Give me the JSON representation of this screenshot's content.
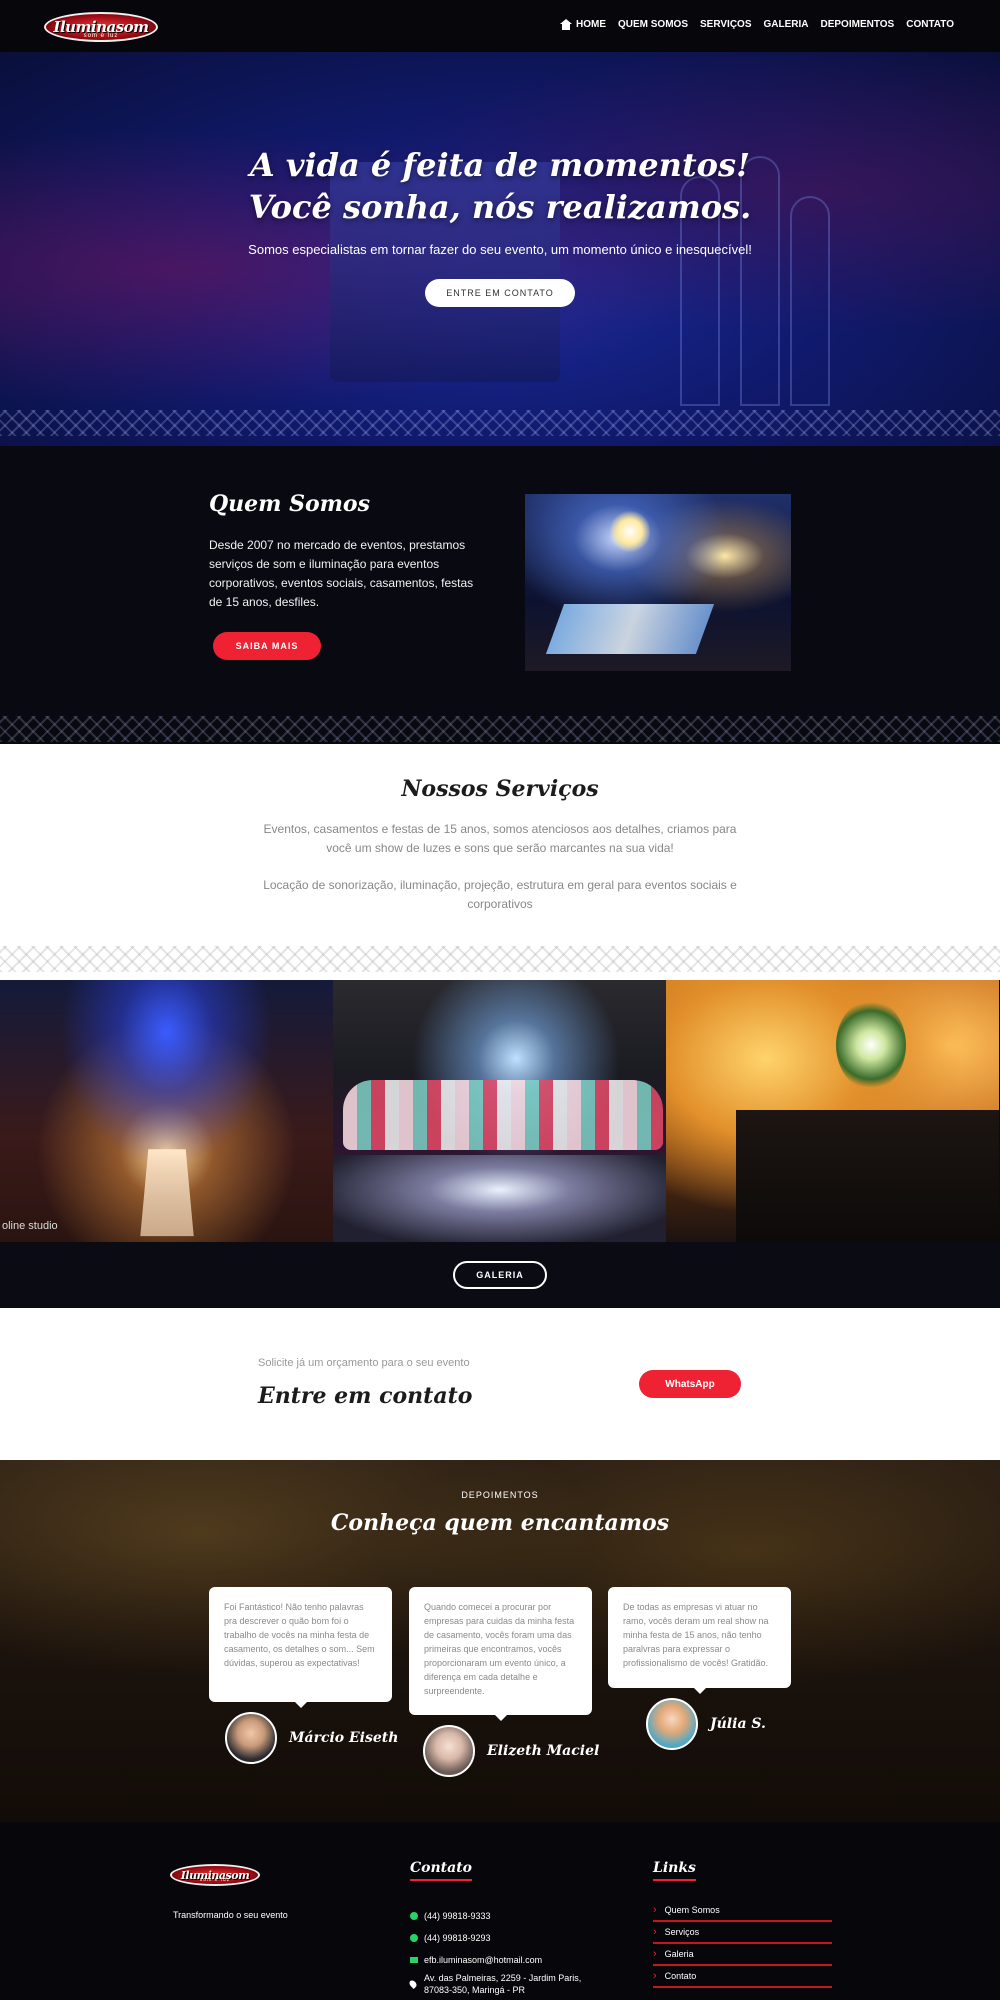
{
  "nav": {
    "logo_text": "Iluminasom",
    "logo_sub": "som e luz",
    "items": [
      "HOME",
      "QUEM SOMOS",
      "SERVIÇOS",
      "GALERIA",
      "DEPOIMENTOS",
      "CONTATO"
    ]
  },
  "hero": {
    "title_line1": "A vida é feita de momentos!",
    "title_line2": "Você sonha, nós realizamos.",
    "subtitle": "Somos especialistas em tornar fazer do seu evento, um momento único e inesquecível!",
    "button": "ENTRE EM CONTATO"
  },
  "about": {
    "title": "Quem Somos",
    "text": "Desde 2007 no mercado de eventos, prestamos serviços de som e iluminação para eventos corporativos, eventos sociais, casamentos, festas de 15 anos, desfiles.",
    "button": "SAIBA MAIS"
  },
  "services": {
    "title": "Nossos Serviços",
    "p1": "Eventos, casamentos e festas de 15 anos, somos atenciosos aos detalhes, criamos para você um show de luzes e sons que serão marcantes na sua vida!",
    "p2": "Locação de sonorização, iluminação, projeção, estrutura em geral para eventos sociais e corporativos"
  },
  "gallery": {
    "caption1": "oline studio",
    "button": "GALERIA"
  },
  "cta": {
    "small": "Solicite já um orçamento para o seu evento",
    "title": "Entre em contato",
    "button": "WhatsApp"
  },
  "testimonials": {
    "overline": "DEPOIMENTOS",
    "title": "Conheça quem encantamos",
    "items": [
      {
        "text": "Foi Fantástico! Não tenho palavras pra descrever o quão bom foi o trabalho de vocês na minha festa de casamento, os detalhes o som... Sem dúvidas, superou as expectativas!",
        "name": "Márcio Eiseth"
      },
      {
        "text": "Quando comecei a procurar por empresas para cuidas da minha festa de casamento, vocês foram uma das primeiras que encontramos, vocês proporcionaram um evento único, a diferença em cada detalhe e surpreendente.",
        "name": "Elizeth Maciel"
      },
      {
        "text": "De todas as empresas vi atuar no ramo, vocês deram um real show na minha festa de 15 anos, não tenho paralvras para expressar o profissionalismo de vocês! Gratidão.",
        "name": "Júlia S."
      }
    ]
  },
  "footer": {
    "tagline": "Transformando o seu evento",
    "contato_title": "Contato",
    "phone1": "(44) 99818-9333",
    "phone2": "(44) 99818-9293",
    "email": "efb.iluminasom@hotmail.com",
    "address_line1": "Av. das Palmeiras, 2259 - Jardim Paris,",
    "address_line2": "87083-350, Maringá - PR",
    "links_title": "Links",
    "links": [
      "Quem Somos",
      "Serviços",
      "Galeria",
      "Contato"
    ]
  }
}
